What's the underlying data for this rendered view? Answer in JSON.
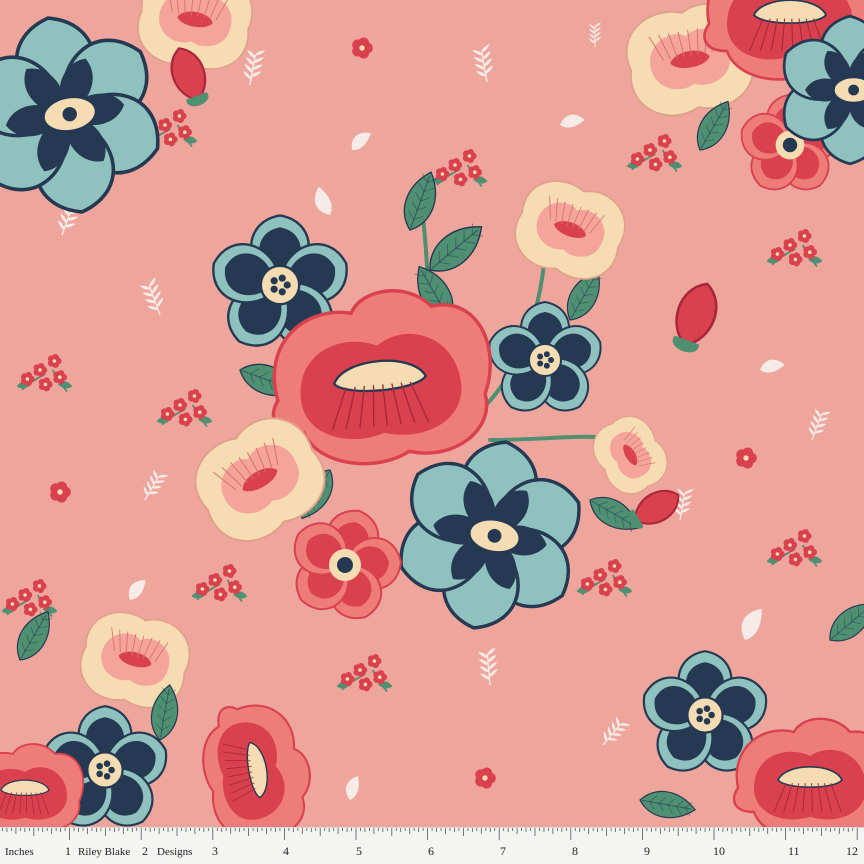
{
  "ruler": {
    "unit_label": "Inches",
    "brand_first": "Riley Blake",
    "brand_second": "Designs",
    "numbers": [
      "1",
      "2",
      "3",
      "4",
      "5",
      "6",
      "7",
      "8",
      "9",
      "10",
      "11",
      "12"
    ]
  },
  "colors": {
    "background": "#eea69c",
    "navy": "#253a52",
    "teal": "#8fc2bf",
    "red": "#d9414f",
    "coral": "#ee7c78",
    "cream": "#f6dcb2",
    "leaf": "#4f8f72",
    "sprig": "#f7ebe8"
  }
}
